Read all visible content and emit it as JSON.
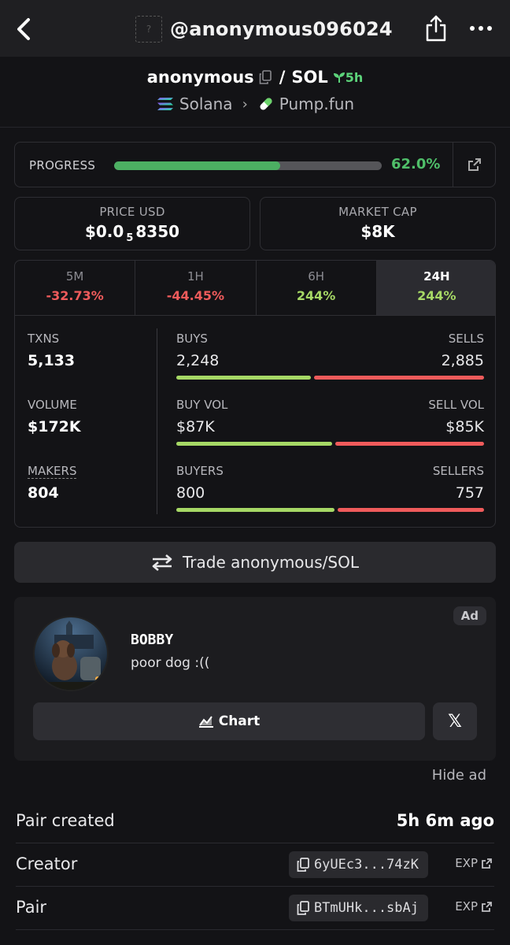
{
  "topbar": {
    "handle": "@anonymous096024",
    "placeholder_glyph": "?"
  },
  "header": {
    "base_token": "anonymous",
    "separator": "/",
    "quote_token": "SOL",
    "age": "5h",
    "chain": "Solana",
    "dex": "Pump.fun"
  },
  "progress": {
    "label": "PROGRESS",
    "value_text": "62.0%",
    "fraction": 0.62
  },
  "price": {
    "label": "PRICE USD",
    "prefix": "$0.0",
    "zeros": "5",
    "digits": "8350"
  },
  "market_cap": {
    "label": "MARKET CAP",
    "value": "$8K"
  },
  "timeframes": [
    {
      "label": "5M",
      "value": "-32.73%",
      "trend": "negative"
    },
    {
      "label": "1H",
      "value": "-44.45%",
      "trend": "negative"
    },
    {
      "label": "6H",
      "value": "244%",
      "trend": "positive"
    },
    {
      "label": "24H",
      "value": "244%",
      "trend": "positive",
      "selected": true
    }
  ],
  "metrics": {
    "txns": {
      "label": "TXNS",
      "value": "5,133"
    },
    "volume": {
      "label": "VOLUME",
      "value": "$172K"
    },
    "makers": {
      "label": "MAKERS",
      "value": "804"
    },
    "buys": {
      "left_label": "BUYS",
      "right_label": "SELLS",
      "left_value": "2,248",
      "right_value": "2,885",
      "left_share": 0.438
    },
    "buy_vol": {
      "left_label": "BUY VOL",
      "right_label": "SELL VOL",
      "left_value": "$87K",
      "right_value": "$85K",
      "left_share": 0.506
    },
    "buyers": {
      "left_label": "BUYERS",
      "right_label": "SELLERS",
      "left_value": "800",
      "right_value": "757",
      "left_share": 0.514
    }
  },
  "trade": {
    "label": "Trade anonymous/SOL"
  },
  "ad": {
    "badge": "Ad",
    "name": "BOBBY",
    "text": "poor dog :((",
    "chart_label": "Chart",
    "x_label": "𝕏",
    "hide_label": "Hide ad"
  },
  "info": {
    "pair_created": {
      "label": "Pair created",
      "value": "5h 6m ago"
    },
    "creator": {
      "label": "Creator",
      "address": "6yUEc3...74zK",
      "exp": "EXP"
    },
    "pair": {
      "label": "Pair",
      "address": "BTmUHk...sbAj",
      "exp": "EXP"
    }
  },
  "colors": {
    "positive": "#a6d865",
    "negative": "#ef5b5b",
    "progress": "#4caf62",
    "age_green": "#5cd37a"
  }
}
